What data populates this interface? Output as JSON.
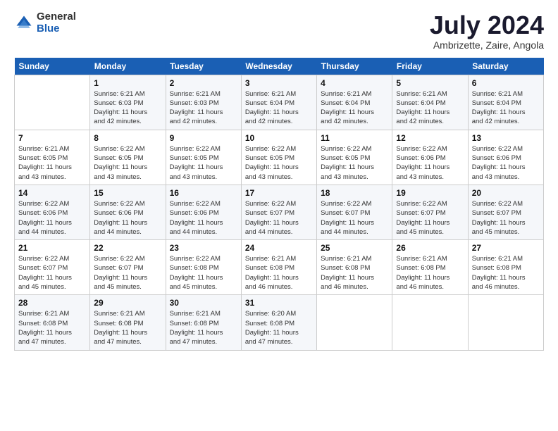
{
  "logo": {
    "general": "General",
    "blue": "Blue"
  },
  "title": "July 2024",
  "subtitle": "Ambrizette, Zaire, Angola",
  "header_days": [
    "Sunday",
    "Monday",
    "Tuesday",
    "Wednesday",
    "Thursday",
    "Friday",
    "Saturday"
  ],
  "weeks": [
    [
      {
        "day": "",
        "info": ""
      },
      {
        "day": "1",
        "info": "Sunrise: 6:21 AM\nSunset: 6:03 PM\nDaylight: 11 hours\nand 42 minutes."
      },
      {
        "day": "2",
        "info": "Sunrise: 6:21 AM\nSunset: 6:03 PM\nDaylight: 11 hours\nand 42 minutes."
      },
      {
        "day": "3",
        "info": "Sunrise: 6:21 AM\nSunset: 6:04 PM\nDaylight: 11 hours\nand 42 minutes."
      },
      {
        "day": "4",
        "info": "Sunrise: 6:21 AM\nSunset: 6:04 PM\nDaylight: 11 hours\nand 42 minutes."
      },
      {
        "day": "5",
        "info": "Sunrise: 6:21 AM\nSunset: 6:04 PM\nDaylight: 11 hours\nand 42 minutes."
      },
      {
        "day": "6",
        "info": "Sunrise: 6:21 AM\nSunset: 6:04 PM\nDaylight: 11 hours\nand 42 minutes."
      }
    ],
    [
      {
        "day": "7",
        "info": "Sunrise: 6:21 AM\nSunset: 6:05 PM\nDaylight: 11 hours\nand 43 minutes."
      },
      {
        "day": "8",
        "info": "Sunrise: 6:22 AM\nSunset: 6:05 PM\nDaylight: 11 hours\nand 43 minutes."
      },
      {
        "day": "9",
        "info": "Sunrise: 6:22 AM\nSunset: 6:05 PM\nDaylight: 11 hours\nand 43 minutes."
      },
      {
        "day": "10",
        "info": "Sunrise: 6:22 AM\nSunset: 6:05 PM\nDaylight: 11 hours\nand 43 minutes."
      },
      {
        "day": "11",
        "info": "Sunrise: 6:22 AM\nSunset: 6:05 PM\nDaylight: 11 hours\nand 43 minutes."
      },
      {
        "day": "12",
        "info": "Sunrise: 6:22 AM\nSunset: 6:06 PM\nDaylight: 11 hours\nand 43 minutes."
      },
      {
        "day": "13",
        "info": "Sunrise: 6:22 AM\nSunset: 6:06 PM\nDaylight: 11 hours\nand 43 minutes."
      }
    ],
    [
      {
        "day": "14",
        "info": "Sunrise: 6:22 AM\nSunset: 6:06 PM\nDaylight: 11 hours\nand 44 minutes."
      },
      {
        "day": "15",
        "info": "Sunrise: 6:22 AM\nSunset: 6:06 PM\nDaylight: 11 hours\nand 44 minutes."
      },
      {
        "day": "16",
        "info": "Sunrise: 6:22 AM\nSunset: 6:06 PM\nDaylight: 11 hours\nand 44 minutes."
      },
      {
        "day": "17",
        "info": "Sunrise: 6:22 AM\nSunset: 6:07 PM\nDaylight: 11 hours\nand 44 minutes."
      },
      {
        "day": "18",
        "info": "Sunrise: 6:22 AM\nSunset: 6:07 PM\nDaylight: 11 hours\nand 44 minutes."
      },
      {
        "day": "19",
        "info": "Sunrise: 6:22 AM\nSunset: 6:07 PM\nDaylight: 11 hours\nand 45 minutes."
      },
      {
        "day": "20",
        "info": "Sunrise: 6:22 AM\nSunset: 6:07 PM\nDaylight: 11 hours\nand 45 minutes."
      }
    ],
    [
      {
        "day": "21",
        "info": "Sunrise: 6:22 AM\nSunset: 6:07 PM\nDaylight: 11 hours\nand 45 minutes."
      },
      {
        "day": "22",
        "info": "Sunrise: 6:22 AM\nSunset: 6:07 PM\nDaylight: 11 hours\nand 45 minutes."
      },
      {
        "day": "23",
        "info": "Sunrise: 6:22 AM\nSunset: 6:08 PM\nDaylight: 11 hours\nand 45 minutes."
      },
      {
        "day": "24",
        "info": "Sunrise: 6:21 AM\nSunset: 6:08 PM\nDaylight: 11 hours\nand 46 minutes."
      },
      {
        "day": "25",
        "info": "Sunrise: 6:21 AM\nSunset: 6:08 PM\nDaylight: 11 hours\nand 46 minutes."
      },
      {
        "day": "26",
        "info": "Sunrise: 6:21 AM\nSunset: 6:08 PM\nDaylight: 11 hours\nand 46 minutes."
      },
      {
        "day": "27",
        "info": "Sunrise: 6:21 AM\nSunset: 6:08 PM\nDaylight: 11 hours\nand 46 minutes."
      }
    ],
    [
      {
        "day": "28",
        "info": "Sunrise: 6:21 AM\nSunset: 6:08 PM\nDaylight: 11 hours\nand 47 minutes."
      },
      {
        "day": "29",
        "info": "Sunrise: 6:21 AM\nSunset: 6:08 PM\nDaylight: 11 hours\nand 47 minutes."
      },
      {
        "day": "30",
        "info": "Sunrise: 6:21 AM\nSunset: 6:08 PM\nDaylight: 11 hours\nand 47 minutes."
      },
      {
        "day": "31",
        "info": "Sunrise: 6:20 AM\nSunset: 6:08 PM\nDaylight: 11 hours\nand 47 minutes."
      },
      {
        "day": "",
        "info": ""
      },
      {
        "day": "",
        "info": ""
      },
      {
        "day": "",
        "info": ""
      }
    ]
  ]
}
